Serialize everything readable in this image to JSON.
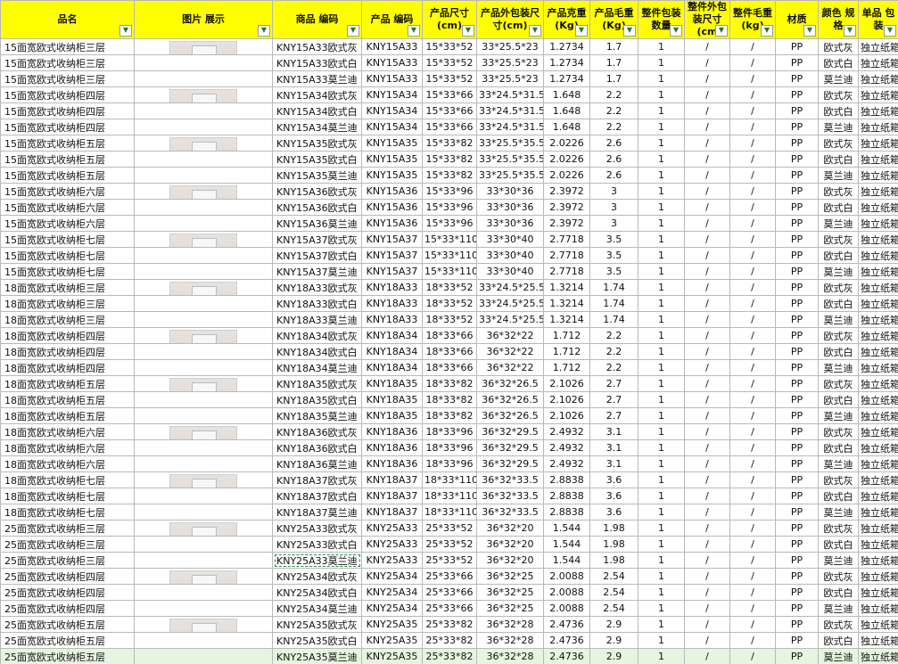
{
  "headers": [
    "品名",
    "图片 展示",
    "商品 编码",
    "产品 编码",
    "产品尺寸 (cm)",
    "产品外包装尺寸(cm)",
    "产品克重 (Kg)",
    "产品毛重 (Kg)",
    "整件包装数量",
    "整件外包装尺寸(cm",
    "整件毛重(kg)",
    "材质",
    "颜色 规格",
    "单品 包装"
  ],
  "rows": [
    [
      "15面宽欧式收纳柜三层",
      "",
      "KNY15A33欧式灰",
      "KNY15A33",
      "15*33*52",
      "33*25.5*23",
      "1.2734",
      "1.7",
      "1",
      "/",
      "/",
      "PP",
      "欧式灰",
      "独立纸箱"
    ],
    [
      "15面宽欧式收纳柜三层",
      "",
      "KNY15A33欧式白",
      "KNY15A33",
      "15*33*52",
      "33*25.5*23",
      "1.2734",
      "1.7",
      "1",
      "/",
      "/",
      "PP",
      "欧式白",
      "独立纸箱"
    ],
    [
      "15面宽欧式收纳柜三层",
      "",
      "KNY15A33莫兰迪",
      "KNY15A33",
      "15*33*52",
      "33*25.5*23",
      "1.2734",
      "1.7",
      "1",
      "/",
      "/",
      "PP",
      "莫兰迪",
      "独立纸箱"
    ],
    [
      "15面宽欧式收纳柜四层",
      "",
      "KNY15A34欧式灰",
      "KNY15A34",
      "15*33*66",
      "33*24.5*31.5",
      "1.648",
      "2.2",
      "1",
      "/",
      "/",
      "PP",
      "欧式灰",
      "独立纸箱"
    ],
    [
      "15面宽欧式收纳柜四层",
      "",
      "KNY15A34欧式白",
      "KNY15A34",
      "15*33*66",
      "33*24.5*31.5",
      "1.648",
      "2.2",
      "1",
      "/",
      "/",
      "PP",
      "欧式白",
      "独立纸箱"
    ],
    [
      "15面宽欧式收纳柜四层",
      "",
      "KNY15A34莫兰迪",
      "KNY15A34",
      "15*33*66",
      "33*24.5*31.5",
      "1.648",
      "2.2",
      "1",
      "/",
      "/",
      "PP",
      "莫兰迪",
      "独立纸箱"
    ],
    [
      "15面宽欧式收纳柜五层",
      "",
      "KNY15A35欧式灰",
      "KNY15A35",
      "15*33*82",
      "33*25.5*35.5",
      "2.0226",
      "2.6",
      "1",
      "/",
      "/",
      "PP",
      "欧式灰",
      "独立纸箱"
    ],
    [
      "15面宽欧式收纳柜五层",
      "",
      "KNY15A35欧式白",
      "KNY15A35",
      "15*33*82",
      "33*25.5*35.5",
      "2.0226",
      "2.6",
      "1",
      "/",
      "/",
      "PP",
      "欧式白",
      "独立纸箱"
    ],
    [
      "15面宽欧式收纳柜五层",
      "",
      "KNY15A35莫兰迪",
      "KNY15A35",
      "15*33*82",
      "33*25.5*35.5",
      "2.0226",
      "2.6",
      "1",
      "/",
      "/",
      "PP",
      "莫兰迪",
      "独立纸箱"
    ],
    [
      "15面宽欧式收纳柜六层",
      "",
      "KNY15A36欧式灰",
      "KNY15A36",
      "15*33*96",
      "33*30*36",
      "2.3972",
      "3",
      "1",
      "/",
      "/",
      "PP",
      "欧式灰",
      "独立纸箱"
    ],
    [
      "15面宽欧式收纳柜六层",
      "",
      "KNY15A36欧式白",
      "KNY15A36",
      "15*33*96",
      "33*30*36",
      "2.3972",
      "3",
      "1",
      "/",
      "/",
      "PP",
      "欧式白",
      "独立纸箱"
    ],
    [
      "15面宽欧式收纳柜六层",
      "",
      "KNY15A36莫兰迪",
      "KNY15A36",
      "15*33*96",
      "33*30*36",
      "2.3972",
      "3",
      "1",
      "/",
      "/",
      "PP",
      "莫兰迪",
      "独立纸箱"
    ],
    [
      "15面宽欧式收纳柜七层",
      "",
      "KNY15A37欧式灰",
      "KNY15A37",
      "15*33*110",
      "33*30*40",
      "2.7718",
      "3.5",
      "1",
      "/",
      "/",
      "PP",
      "欧式灰",
      "独立纸箱"
    ],
    [
      "15面宽欧式收纳柜七层",
      "",
      "KNY15A37欧式白",
      "KNY15A37",
      "15*33*110",
      "33*30*40",
      "2.7718",
      "3.5",
      "1",
      "/",
      "/",
      "PP",
      "欧式白",
      "独立纸箱"
    ],
    [
      "15面宽欧式收纳柜七层",
      "",
      "KNY15A37莫兰迪",
      "KNY15A37",
      "15*33*110",
      "33*30*40",
      "2.7718",
      "3.5",
      "1",
      "/",
      "/",
      "PP",
      "莫兰迪",
      "独立纸箱"
    ],
    [
      "18面宽欧式收纳柜三层",
      "",
      "KNY18A33欧式灰",
      "KNY18A33",
      "18*33*52",
      "33*24.5*25.5",
      "1.3214",
      "1.74",
      "1",
      "/",
      "/",
      "PP",
      "欧式灰",
      "独立纸箱"
    ],
    [
      "18面宽欧式收纳柜三层",
      "",
      "KNY18A33欧式白",
      "KNY18A33",
      "18*33*52",
      "33*24.5*25.5",
      "1.3214",
      "1.74",
      "1",
      "/",
      "/",
      "PP",
      "欧式白",
      "独立纸箱"
    ],
    [
      "18面宽欧式收纳柜三层",
      "",
      "KNY18A33莫兰迪",
      "KNY18A33",
      "18*33*52",
      "33*24.5*25.5",
      "1.3214",
      "1.74",
      "1",
      "/",
      "/",
      "PP",
      "莫兰迪",
      "独立纸箱"
    ],
    [
      "18面宽欧式收纳柜四层",
      "",
      "KNY18A34欧式灰",
      "KNY18A34",
      "18*33*66",
      "36*32*22",
      "1.712",
      "2.2",
      "1",
      "/",
      "/",
      "PP",
      "欧式灰",
      "独立纸箱"
    ],
    [
      "18面宽欧式收纳柜四层",
      "",
      "KNY18A34欧式白",
      "KNY18A34",
      "18*33*66",
      "36*32*22",
      "1.712",
      "2.2",
      "1",
      "/",
      "/",
      "PP",
      "欧式白",
      "独立纸箱"
    ],
    [
      "18面宽欧式收纳柜四层",
      "",
      "KNY18A34莫兰迪",
      "KNY18A34",
      "18*33*66",
      "36*32*22",
      "1.712",
      "2.2",
      "1",
      "/",
      "/",
      "PP",
      "莫兰迪",
      "独立纸箱"
    ],
    [
      "18面宽欧式收纳柜五层",
      "",
      "KNY18A35欧式灰",
      "KNY18A35",
      "18*33*82",
      "36*32*26.5",
      "2.1026",
      "2.7",
      "1",
      "/",
      "/",
      "PP",
      "欧式灰",
      "独立纸箱"
    ],
    [
      "18面宽欧式收纳柜五层",
      "",
      "KNY18A35欧式白",
      "KNY18A35",
      "18*33*82",
      "36*32*26.5",
      "2.1026",
      "2.7",
      "1",
      "/",
      "/",
      "PP",
      "欧式白",
      "独立纸箱"
    ],
    [
      "18面宽欧式收纳柜五层",
      "",
      "KNY18A35莫兰迪",
      "KNY18A35",
      "18*33*82",
      "36*32*26.5",
      "2.1026",
      "2.7",
      "1",
      "/",
      "/",
      "PP",
      "莫兰迪",
      "独立纸箱"
    ],
    [
      "18面宽欧式收纳柜六层",
      "",
      "KNY18A36欧式灰",
      "KNY18A36",
      "18*33*96",
      "36*32*29.5",
      "2.4932",
      "3.1",
      "1",
      "/",
      "/",
      "PP",
      "欧式灰",
      "独立纸箱"
    ],
    [
      "18面宽欧式收纳柜六层",
      "",
      "KNY18A36欧式白",
      "KNY18A36",
      "18*33*96",
      "36*32*29.5",
      "2.4932",
      "3.1",
      "1",
      "/",
      "/",
      "PP",
      "欧式白",
      "独立纸箱"
    ],
    [
      "18面宽欧式收纳柜六层",
      "",
      "KNY18A36莫兰迪",
      "KNY18A36",
      "18*33*96",
      "36*32*29.5",
      "2.4932",
      "3.1",
      "1",
      "/",
      "/",
      "PP",
      "莫兰迪",
      "独立纸箱"
    ],
    [
      "18面宽欧式收纳柜七层",
      "",
      "KNY18A37欧式灰",
      "KNY18A37",
      "18*33*110",
      "36*32*33.5",
      "2.8838",
      "3.6",
      "1",
      "/",
      "/",
      "PP",
      "欧式灰",
      "独立纸箱"
    ],
    [
      "18面宽欧式收纳柜七层",
      "",
      "KNY18A37欧式白",
      "KNY18A37",
      "18*33*110",
      "36*32*33.5",
      "2.8838",
      "3.6",
      "1",
      "/",
      "/",
      "PP",
      "欧式白",
      "独立纸箱"
    ],
    [
      "18面宽欧式收纳柜七层",
      "",
      "KNY18A37莫兰迪",
      "KNY18A37",
      "18*33*110",
      "36*32*33.5",
      "2.8838",
      "3.6",
      "1",
      "/",
      "/",
      "PP",
      "莫兰迪",
      "独立纸箱"
    ],
    [
      "25面宽欧式收纳柜三层",
      "",
      "KNY25A33欧式灰",
      "KNY25A33",
      "25*33*52",
      "36*32*20",
      "1.544",
      "1.98",
      "1",
      "/",
      "/",
      "PP",
      "欧式灰",
      "独立纸箱"
    ],
    [
      "25面宽欧式收纳柜三层",
      "",
      "KNY25A33欧式白",
      "KNY25A33",
      "25*33*52",
      "36*32*20",
      "1.544",
      "1.98",
      "1",
      "/",
      "/",
      "PP",
      "欧式白",
      "独立纸箱"
    ],
    [
      "25面宽欧式收纳柜三层",
      "",
      "KNY25A33莫兰迪",
      "KNY25A33",
      "25*33*52",
      "36*32*20",
      "1.544",
      "1.98",
      "1",
      "/",
      "/",
      "PP",
      "莫兰迪",
      "独立纸箱"
    ],
    [
      "25面宽欧式收纳柜四层",
      "",
      "KNY25A34欧式灰",
      "KNY25A34",
      "25*33*66",
      "36*32*25",
      "2.0088",
      "2.54",
      "1",
      "/",
      "/",
      "PP",
      "欧式灰",
      "独立纸箱"
    ],
    [
      "25面宽欧式收纳柜四层",
      "",
      "KNY25A34欧式白",
      "KNY25A34",
      "25*33*66",
      "36*32*25",
      "2.0088",
      "2.54",
      "1",
      "/",
      "/",
      "PP",
      "欧式白",
      "独立纸箱"
    ],
    [
      "25面宽欧式收纳柜四层",
      "",
      "KNY25A34莫兰迪",
      "KNY25A34",
      "25*33*66",
      "36*32*25",
      "2.0088",
      "2.54",
      "1",
      "/",
      "/",
      "PP",
      "莫兰迪",
      "独立纸箱"
    ],
    [
      "25面宽欧式收纳柜五层",
      "",
      "KNY25A35欧式灰",
      "KNY25A35",
      "25*33*82",
      "36*32*28",
      "2.4736",
      "2.9",
      "1",
      "/",
      "/",
      "PP",
      "欧式灰",
      "独立纸箱"
    ],
    [
      "25面宽欧式收纳柜五层",
      "",
      "KNY25A35欧式白",
      "KNY25A35",
      "25*33*82",
      "36*32*28",
      "2.4736",
      "2.9",
      "1",
      "/",
      "/",
      "PP",
      "欧式白",
      "独立纸箱"
    ],
    [
      "25面宽欧式收纳柜五层",
      "",
      "KNY25A35莫兰迪",
      "KNY25A35",
      "25*33*82",
      "36*32*28",
      "2.4736",
      "2.9",
      "1",
      "/",
      "/",
      "PP",
      "莫兰迪",
      "独立纸箱"
    ]
  ],
  "filter_icon": "dropdown-arrow-icon"
}
